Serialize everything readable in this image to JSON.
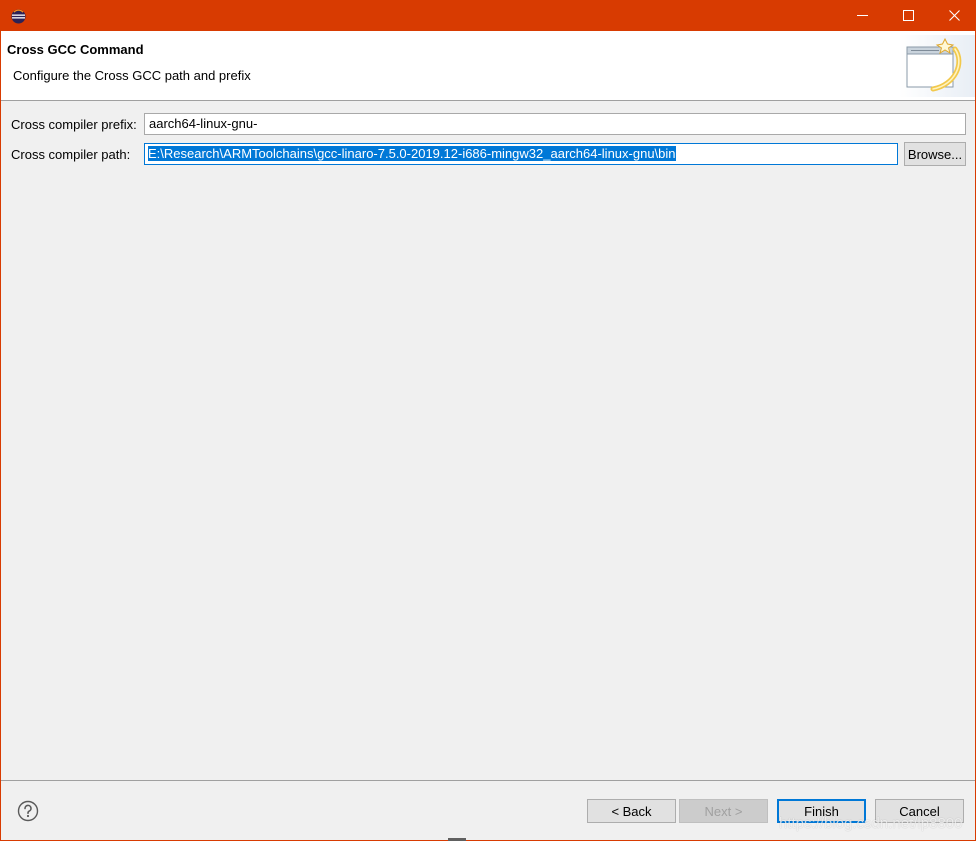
{
  "window": {
    "app_icon": "eclipse-icon",
    "controls": {
      "minimize": "minimize-icon",
      "maximize": "maximize-icon",
      "close": "close-icon"
    },
    "colors": {
      "titlebar": "#d83b01",
      "accent": "#0078d7"
    }
  },
  "header": {
    "title": "Cross GCC Command",
    "description": "Configure the Cross GCC path and prefix",
    "banner_icon": "wizard-banner-icon"
  },
  "form": {
    "prefix_label": "Cross compiler prefix:",
    "prefix_value": "aarch64-linux-gnu-",
    "path_label": "Cross compiler path:",
    "path_value": "E:\\Research\\ARMToolchains\\gcc-linaro-7.5.0-2019.12-i686-mingw32_aarch64-linux-gnu\\bin",
    "browse_label": "Browse..."
  },
  "footer": {
    "help_icon": "help-icon",
    "back_label": "< Back",
    "next_label": "Next >",
    "finish_label": "Finish",
    "cancel_label": "Cancel",
    "watermark": "https://blog.csdn.net/lp8800"
  }
}
